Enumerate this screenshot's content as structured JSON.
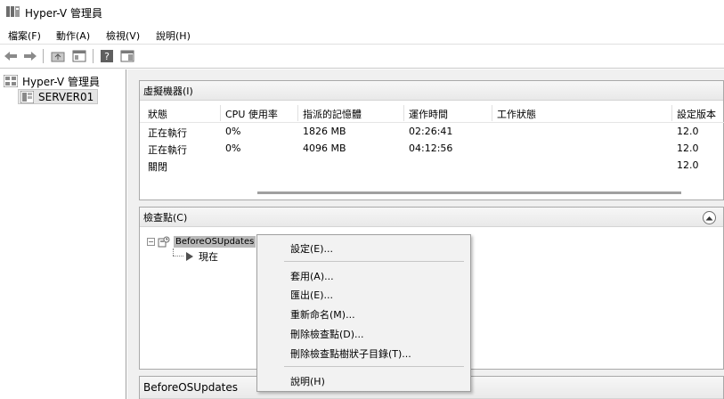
{
  "window": {
    "title": "Hyper-V 管理員"
  },
  "menubar": {
    "items": [
      "檔案(F)",
      "動作(A)",
      "檢視(V)",
      "說明(H)"
    ]
  },
  "toolbar": {
    "buttons": [
      "back-arrow-icon",
      "forward-arrow-icon",
      "up-folder-icon",
      "show-hide-console-tree-icon",
      "help-icon",
      "action-pane-icon"
    ]
  },
  "nav": {
    "root_label": "Hyper-V 管理員",
    "server_label": "SERVER01"
  },
  "vm_panel": {
    "title": "虛擬機器(I)",
    "columns": [
      "狀態",
      "CPU 使用率",
      "指派的記憶體",
      "運作時間",
      "工作狀態",
      "設定版本"
    ],
    "rows": [
      [
        "正在執行",
        "0%",
        "1826 MB",
        "02:26:41",
        "",
        "12.0"
      ],
      [
        "正在執行",
        "0%",
        "4096 MB",
        "04:12:56",
        "",
        "12.0"
      ],
      [
        "關閉",
        "",
        "",
        "",
        "",
        "12.0"
      ]
    ]
  },
  "checkpoint_panel": {
    "title": "檢查點(C)",
    "checkpoint_name": "BeforeOSUpdates",
    "now_label": "現在"
  },
  "detail_panel": {
    "title": "BeforeOSUpdates"
  },
  "context_menu": {
    "items": [
      "設定(E)...",
      "套用(A)...",
      "匯出(E)...",
      "重新命名(M)...",
      "刪除檢查點(D)...",
      "刪除檢查點樹狀子目錄(T)...",
      "說明(H)"
    ]
  }
}
